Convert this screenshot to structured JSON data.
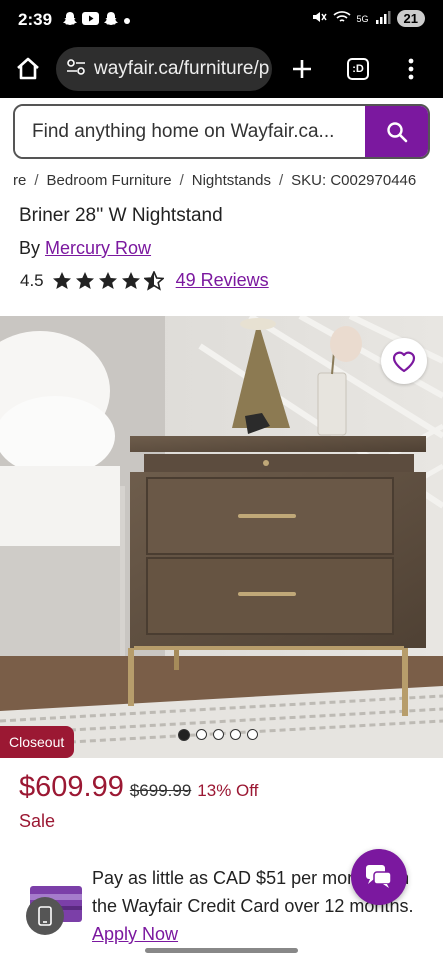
{
  "status": {
    "time": "2:39",
    "network": "5G",
    "battery": "21"
  },
  "browser": {
    "url": "wayfair.ca/furniture/p",
    "tab_label": ":D"
  },
  "search": {
    "placeholder": "Find anything home on Wayfair.ca..."
  },
  "breadcrumb": [
    "re",
    "Bedroom Furniture",
    "Nightstands",
    "SKU: C002970446"
  ],
  "product": {
    "title": "Briner 28'' W Nightstand",
    "by_label": "By",
    "brand": "Mercury Row",
    "rating": "4.5",
    "rating_value": 4.5,
    "reviews_link": "49 Reviews",
    "badge": "Closeout",
    "image_dots": {
      "count": 5,
      "active": 0
    }
  },
  "pricing": {
    "price": "$609.99",
    "old_price": "$699.99",
    "discount": "13% Off",
    "sale_label": "Sale"
  },
  "financing": {
    "line": "Pay as little as CAD $51 per month with the Wayfair Credit Card over 12 months.",
    "apply": "Apply Now"
  },
  "colors": {
    "brand_purple": "#7b189f",
    "sale_red": "#9b1833"
  }
}
